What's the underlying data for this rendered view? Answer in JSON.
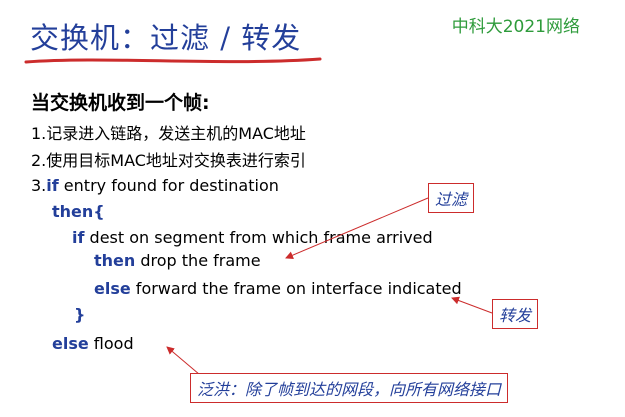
{
  "slide": {
    "title": "交换机：过滤 / 转发",
    "brand": "中科大2021网络",
    "subtitle": "当交换机收到一个帧:",
    "steps": [
      "1.记录进入链路，发送主机的MAC地址",
      "2.使用目标MAC地址对交换表进行索引"
    ],
    "step3": {
      "num": "3.",
      "if": "if",
      "if_rest": " entry found for destination",
      "then": "then{",
      "inner_if": "if",
      "inner_if_rest": " dest on segment from which frame arrived",
      "inner_then": "then",
      "inner_then_rest": " drop the frame",
      "inner_else": "else",
      "inner_else_rest": " forward the frame on interface indicated",
      "close": "}",
      "else": "else",
      "else_rest": " flood"
    },
    "callouts": {
      "filter": "过滤",
      "forward": "转发",
      "flood": "泛洪：除了帧到达的网段，向所有网络接口"
    },
    "colors": {
      "title": "#233f9a",
      "brand": "#2e9b3b",
      "keyword": "#233f9a",
      "accent": "#cc2c2c"
    }
  }
}
